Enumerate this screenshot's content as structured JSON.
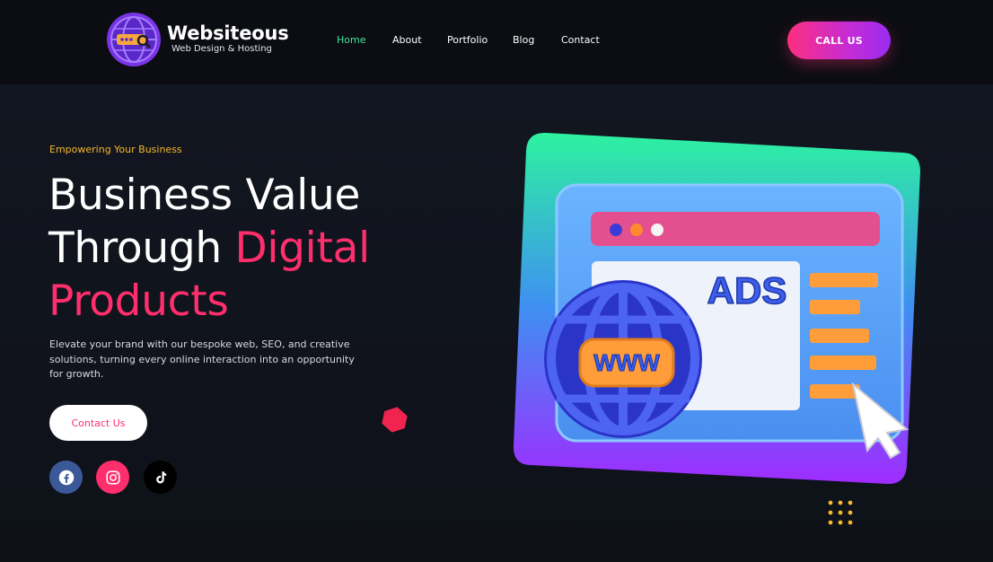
{
  "brand": {
    "name": "Websiteous",
    "tagline": "Web Design & Hosting"
  },
  "nav": {
    "items": [
      {
        "label": "Home",
        "active": true
      },
      {
        "label": "About"
      },
      {
        "label": "Portfolio"
      },
      {
        "label": "Blog"
      },
      {
        "label": "Contact"
      }
    ],
    "cta": "CALL US"
  },
  "hero": {
    "eyebrow": "Empowering Your Business",
    "headline_line1": "Business Value",
    "headline_line2a": "Through",
    "headline_line2b": "Digital",
    "headline_line3": "Products",
    "description": "Elevate your brand with our bespoke web, SEO, and creative solutions, turning every online interaction into an opportunity for growth.",
    "contact_button": "Contact Us"
  },
  "social": [
    {
      "name": "facebook-icon",
      "color": "#3b5998"
    },
    {
      "name": "instagram-icon",
      "color": "#ff2f6d"
    },
    {
      "name": "tiktok-icon",
      "color": "#000000"
    }
  ],
  "illustration": {
    "ads_text": "ADS",
    "globe_text": "WWW"
  },
  "colors": {
    "accent_pink": "#ff2f6d",
    "accent_green": "#3ee6a3",
    "accent_yellow": "#f6b72a",
    "background": "#0e1118"
  }
}
